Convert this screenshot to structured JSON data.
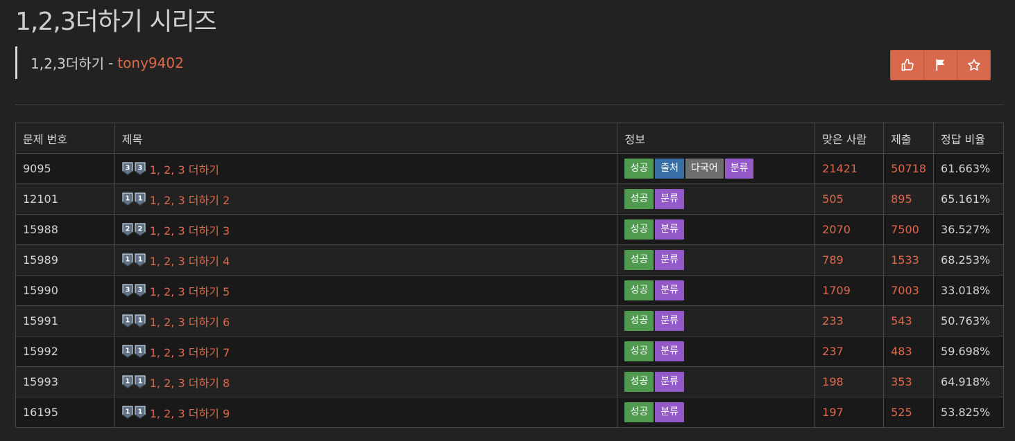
{
  "page": {
    "title": "1,2,3더하기 시리즈",
    "subtitle": "1,2,3더하기",
    "separator": "-",
    "author": "tony9402"
  },
  "actions": [
    {
      "name": "like",
      "icon": "thumbs-up-icon"
    },
    {
      "name": "report",
      "icon": "flag-icon"
    },
    {
      "name": "favorite",
      "icon": "star-icon"
    }
  ],
  "colors": {
    "accent": "#e0684a",
    "action_bg": "#d9694d",
    "success": "#4f9a4f",
    "source": "#386ea3",
    "multilang": "#6e6e6e",
    "category": "#9459c9",
    "tier_silver3": "#5f6f84",
    "tier_silver1": "#5f6f84"
  },
  "table": {
    "headers": {
      "id": "문제 번호",
      "title": "제목",
      "info": "정보",
      "solved": "맞은 사람",
      "submissions": "제출",
      "ratio": "정답 비율"
    },
    "rows": [
      {
        "id": "9095",
        "tier": "3",
        "title": "1, 2, 3 더하기",
        "badges": [
          "성공",
          "출처",
          "다국어",
          "분류"
        ],
        "solved": "21421",
        "submissions": "50718",
        "ratio": "61.663%"
      },
      {
        "id": "12101",
        "tier": "1",
        "title": "1, 2, 3 더하기 2",
        "badges": [
          "성공",
          "분류"
        ],
        "solved": "505",
        "submissions": "895",
        "ratio": "65.161%"
      },
      {
        "id": "15988",
        "tier": "2",
        "title": "1, 2, 3 더하기 3",
        "badges": [
          "성공",
          "분류"
        ],
        "solved": "2070",
        "submissions": "7500",
        "ratio": "36.527%"
      },
      {
        "id": "15989",
        "tier": "1",
        "title": "1, 2, 3 더하기 4",
        "badges": [
          "성공",
          "분류"
        ],
        "solved": "789",
        "submissions": "1533",
        "ratio": "68.253%"
      },
      {
        "id": "15990",
        "tier": "3",
        "title": "1, 2, 3 더하기 5",
        "badges": [
          "성공",
          "분류"
        ],
        "solved": "1709",
        "submissions": "7003",
        "ratio": "33.018%"
      },
      {
        "id": "15991",
        "tier": "1",
        "title": "1, 2, 3 더하기 6",
        "badges": [
          "성공",
          "분류"
        ],
        "solved": "233",
        "submissions": "543",
        "ratio": "50.763%"
      },
      {
        "id": "15992",
        "tier": "1",
        "title": "1, 2, 3 더하기 7",
        "badges": [
          "성공",
          "분류"
        ],
        "solved": "237",
        "submissions": "483",
        "ratio": "59.698%"
      },
      {
        "id": "15993",
        "tier": "1",
        "title": "1, 2, 3 더하기 8",
        "badges": [
          "성공",
          "분류"
        ],
        "solved": "198",
        "submissions": "353",
        "ratio": "64.918%"
      },
      {
        "id": "16195",
        "tier": "1",
        "title": "1, 2, 3 더하기 9",
        "badges": [
          "성공",
          "분류"
        ],
        "solved": "197",
        "submissions": "525",
        "ratio": "53.825%"
      }
    ]
  }
}
